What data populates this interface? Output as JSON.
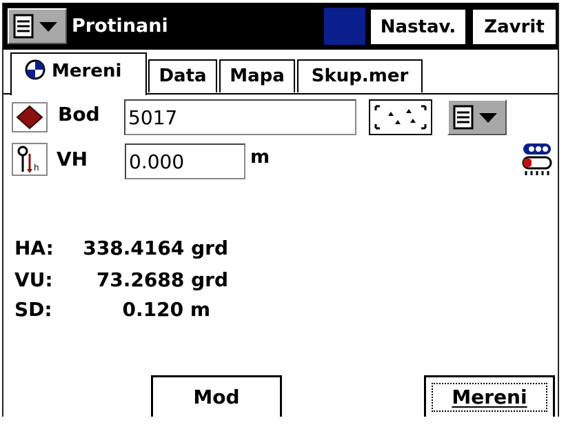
{
  "window": {
    "title": "Protinani",
    "buttons": {
      "settings": "Nastav.",
      "close": "Zavrit"
    }
  },
  "tabs": [
    {
      "label": "Mereni",
      "active": true
    },
    {
      "label": "Data",
      "active": false
    },
    {
      "label": "Mapa",
      "active": false
    },
    {
      "label": "Skup.mer",
      "active": false
    }
  ],
  "form": {
    "point": {
      "label": "Bod",
      "value": "5017"
    },
    "height": {
      "label": "VH",
      "value": "0.000",
      "unit": "m"
    }
  },
  "readouts": [
    {
      "label": "HA:",
      "value": "338.4164 grd"
    },
    {
      "label": "VU:",
      "value": "73.2688 grd"
    },
    {
      "label": "SD:",
      "value": "0.120 m"
    }
  ],
  "buttons": {
    "mode": "Mod",
    "measure": "Mereni"
  },
  "colors": {
    "titlebar": "#000000",
    "accent_block": "#0a1f8c",
    "point_marker": "#8b1010"
  }
}
